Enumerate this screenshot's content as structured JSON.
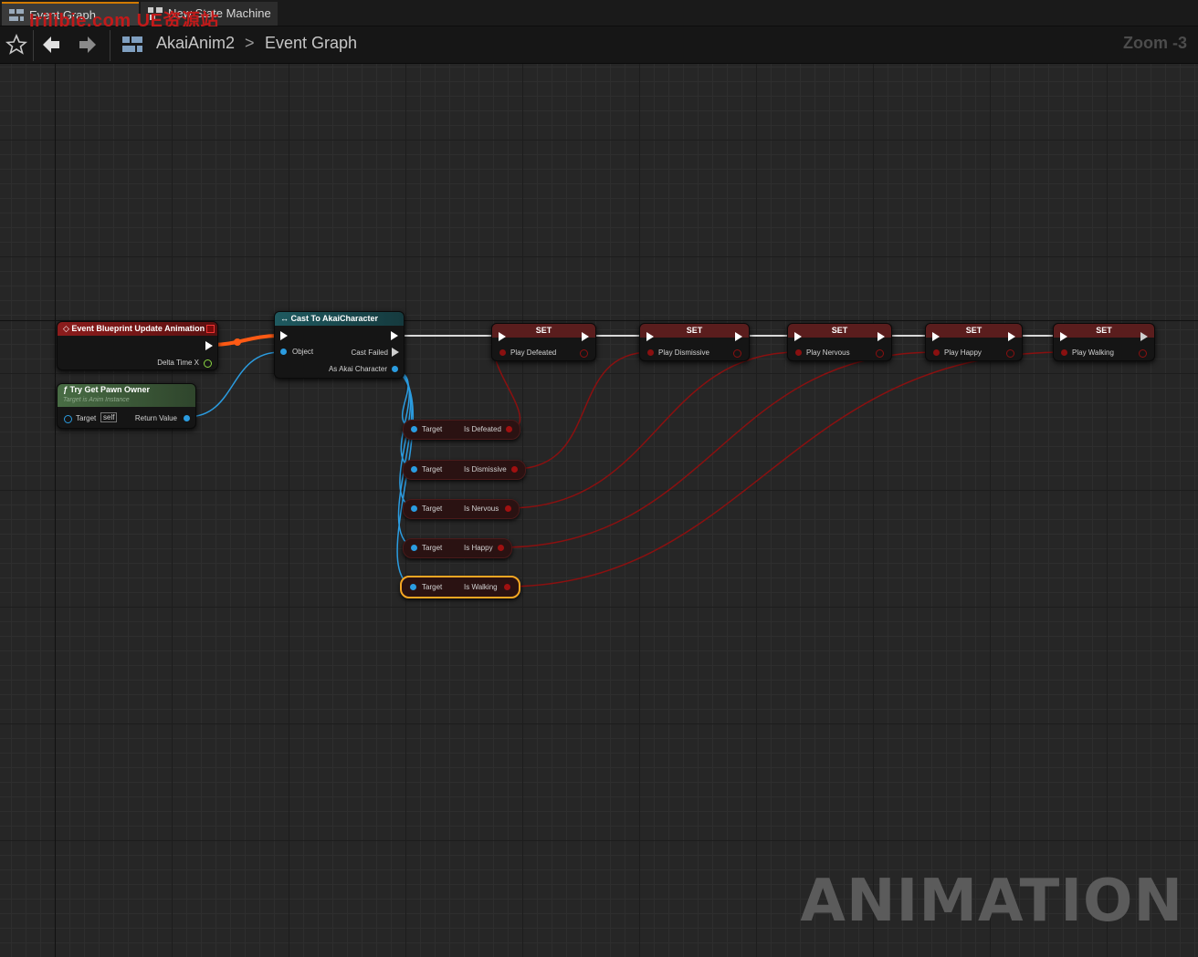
{
  "tabs": [
    {
      "label": "Event Graph",
      "active": true
    },
    {
      "label": "New State Machine",
      "active": false
    }
  ],
  "watermark_text": "Irilibie.com  UE资源站",
  "toolbar": {
    "icons": [
      "star-icon",
      "back-arrow-icon",
      "forward-arrow-icon",
      "graph-icon"
    ],
    "breadcrumb": [
      "AkaiAnim2",
      "Event Graph"
    ],
    "separator": ">",
    "zoom": "Zoom -3"
  },
  "nodes": {
    "event": {
      "title": "Event Blueprint Update Animation",
      "pin_out": "Delta Time X"
    },
    "pawn": {
      "title": "Try Get Pawn Owner",
      "subtitle": "Target is Anim Instance",
      "target_label": "Target",
      "target_default": "self",
      "return_label": "Return Value"
    },
    "cast": {
      "title": "Cast To AkaiCharacter",
      "object_label": "Object",
      "cast_failed": "Cast Failed",
      "as_label": "As Akai Character"
    },
    "setters": [
      {
        "title": "SET",
        "var": "Play Defeated"
      },
      {
        "title": "SET",
        "var": "Play Dismissive"
      },
      {
        "title": "SET",
        "var": "Play Nervous"
      },
      {
        "title": "SET",
        "var": "Play Happy"
      },
      {
        "title": "SET",
        "var": "Play Walking"
      }
    ],
    "getters": [
      {
        "target": "Target",
        "var": "Is Defeated"
      },
      {
        "target": "Target",
        "var": "Is Dismissive"
      },
      {
        "target": "Target",
        "var": "Is Nervous"
      },
      {
        "target": "Target",
        "var": "Is Happy"
      },
      {
        "target": "Target",
        "var": "Is Walking",
        "selected": true
      }
    ]
  },
  "graph_watermark": "ANIMATION",
  "colors": {
    "exec_wire": "#d9d9d9",
    "object_wire": "#2b9ce0",
    "bool_wire": "#8a1010",
    "float_wire": "#ff5a14",
    "event_header": "#8c1c1c",
    "function_header": "#486c44",
    "cast_header": "#1f5a60",
    "setter_header": "#5a1d1d",
    "selection": "#f5a623"
  }
}
